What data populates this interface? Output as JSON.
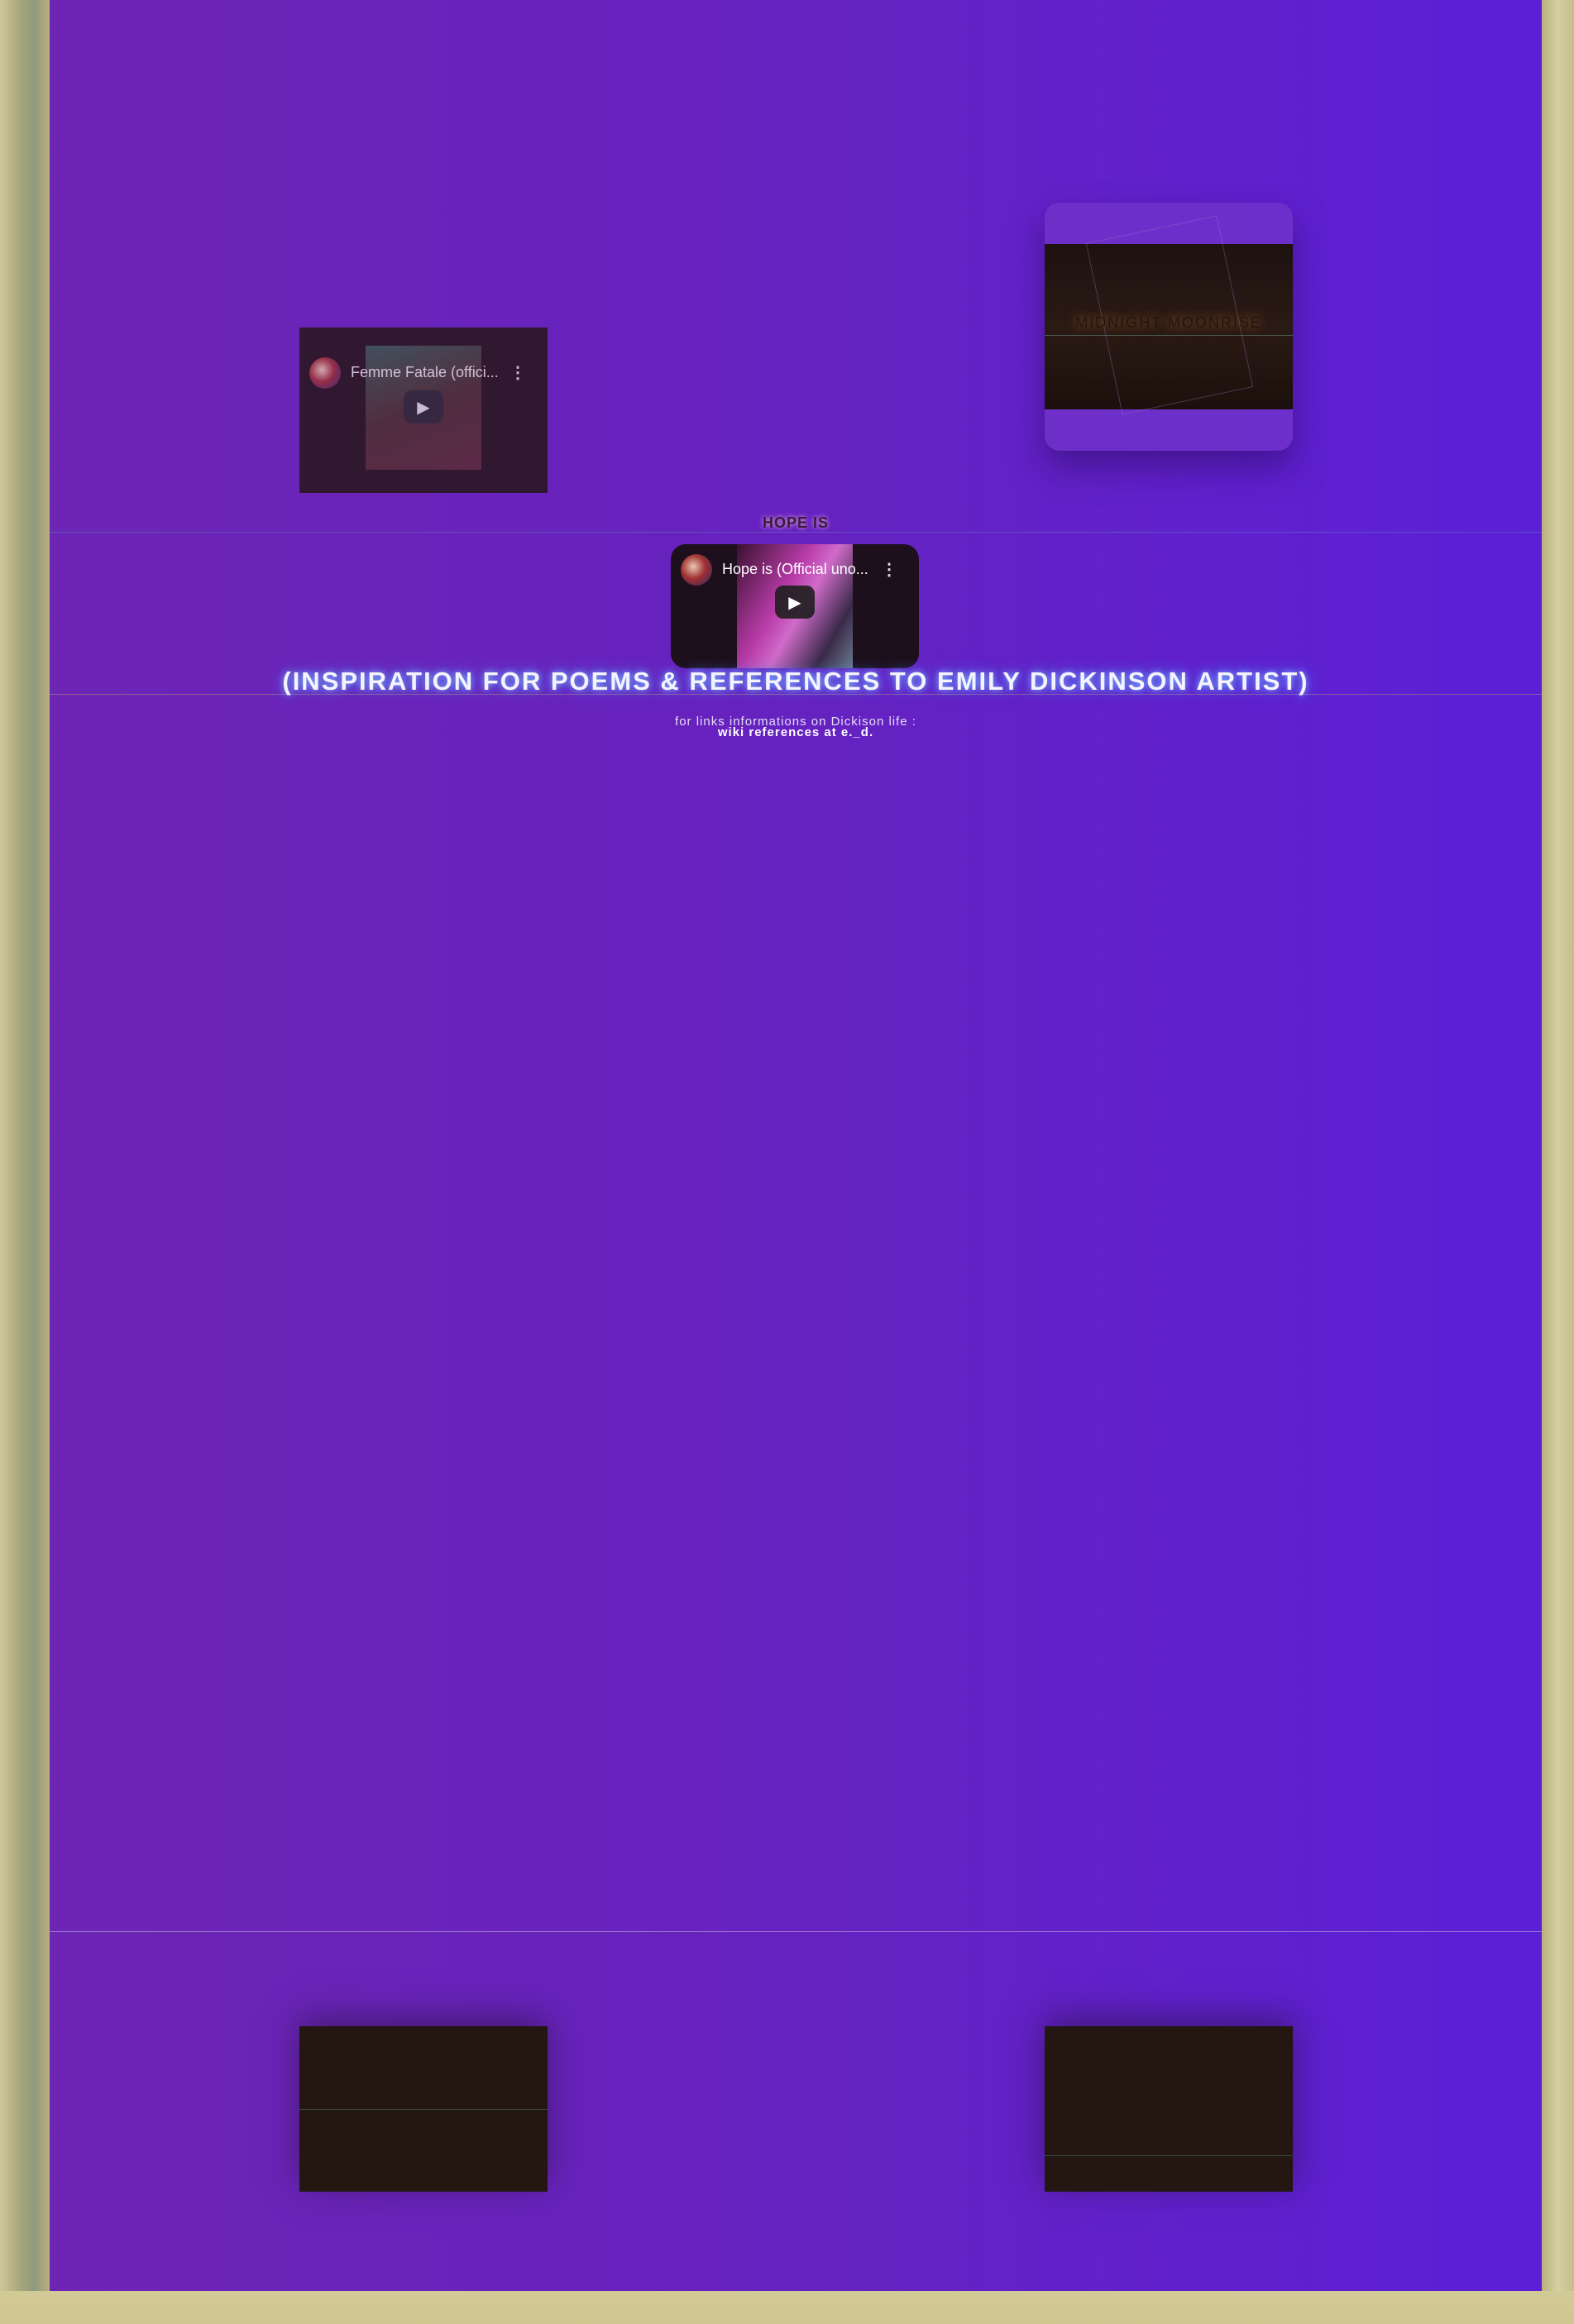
{
  "videos": {
    "femme_fatale": {
      "title": "Femme Fatale (offici...",
      "play_icon": "▶",
      "menu_icon": "⋮"
    },
    "hope_is": {
      "title": "Hope is (Official uno...",
      "play_icon": "▶",
      "menu_icon": "⋮"
    }
  },
  "moonrise_card": {
    "label": "MIDNIGHT MOONRISE"
  },
  "hope_heading": "HOPE IS",
  "inspiration_heading": "(INSPIRATION FOR POEMS & REFERENCES TO EMILY DICKINSON ARTIST)",
  "links_caption": "for links informations on Dickison life :",
  "wiki_link": "wiki references at e._d.",
  "colors": {
    "background": "#6622c0",
    "frame": "#c8c08a",
    "glow": "#4a86ff"
  }
}
